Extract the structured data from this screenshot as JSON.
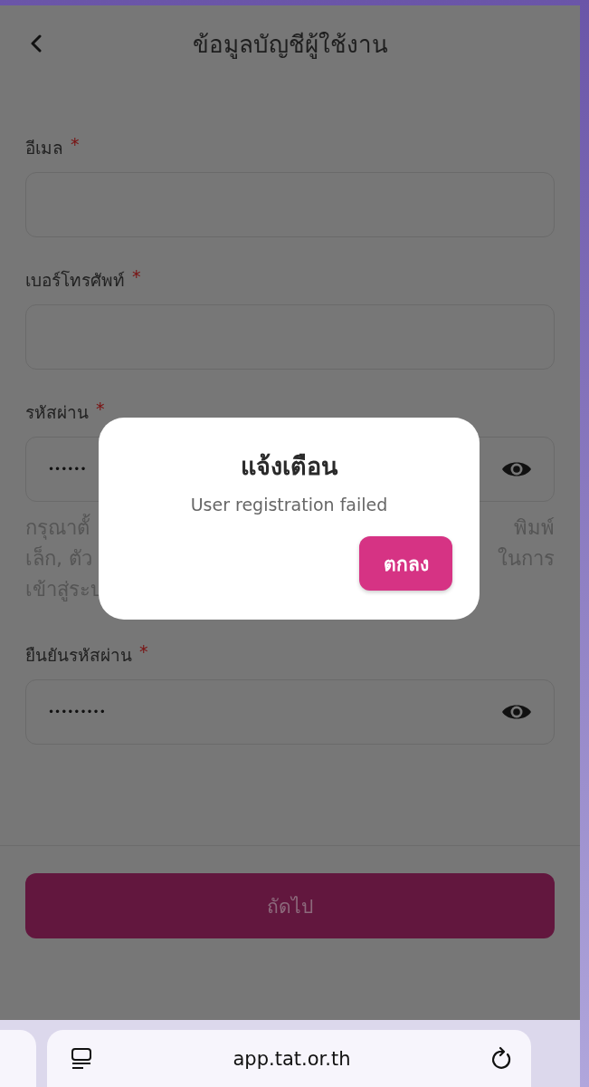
{
  "header": {
    "title": "ข้อมูลบัญชีผู้ใช้งาน"
  },
  "fields": [
    {
      "kind": "text",
      "label": "อีเมล",
      "required_mark": "*"
    },
    {
      "kind": "text",
      "label": "เบอร์โทรศัพท์",
      "required_mark": "*"
    },
    {
      "kind": "password",
      "label": "รหัสผ่าน",
      "required_mark": "*",
      "value": "••••••"
    },
    {
      "kind": "hint",
      "lines": [
        {
          "left": "กรุณาตั้",
          "right": "พิมพ์"
        },
        {
          "left": "เล็ก, ตัว",
          "right": "ในการ"
        },
        {
          "left": "เข้าสู่ระบ"
        }
      ]
    },
    {
      "kind": "password",
      "label": "ยืนยันรหัสผ่าน",
      "required_mark": "*",
      "value": "•••••••••"
    }
  ],
  "next_button": {
    "label": "ถัดไป",
    "disabled": true
  },
  "dialog": {
    "title": "แจ้งเตือน",
    "message": "User registration failed",
    "button": "ตกลง"
  },
  "browser_bar": {
    "url": "app.tat.or.th"
  }
}
